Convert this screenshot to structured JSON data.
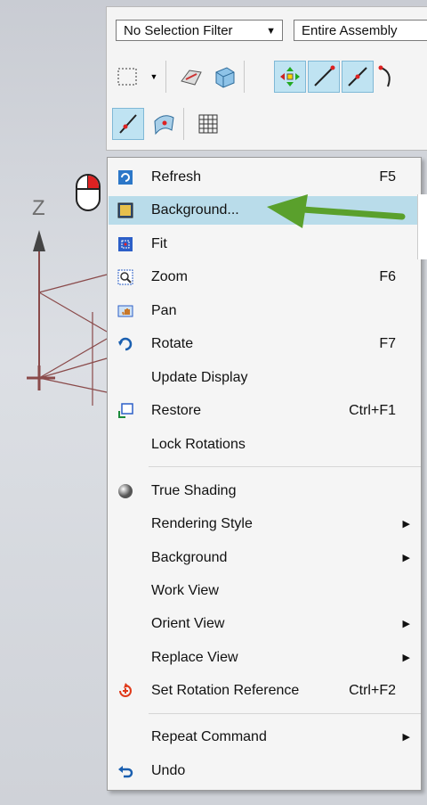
{
  "toolbar": {
    "selection_filter": "No Selection Filter",
    "scope": "Entire Assembly"
  },
  "axis": {
    "label": "Z"
  },
  "menu": {
    "items": [
      {
        "label": "Refresh",
        "shortcut": "F5"
      },
      {
        "label": "Background...",
        "shortcut": ""
      },
      {
        "label": "Fit",
        "shortcut": ""
      },
      {
        "label": "Zoom",
        "shortcut": "F6"
      },
      {
        "label": "Pan",
        "shortcut": ""
      },
      {
        "label": "Rotate",
        "shortcut": "F7"
      },
      {
        "label": "Update Display",
        "shortcut": ""
      },
      {
        "label": "Restore",
        "shortcut": "Ctrl+F1"
      },
      {
        "label": "Lock Rotations",
        "shortcut": ""
      },
      {
        "label": "True Shading",
        "shortcut": ""
      },
      {
        "label": "Rendering Style",
        "shortcut": ""
      },
      {
        "label": "Background",
        "shortcut": ""
      },
      {
        "label": "Work View",
        "shortcut": ""
      },
      {
        "label": "Orient View",
        "shortcut": ""
      },
      {
        "label": "Replace View",
        "shortcut": ""
      },
      {
        "label": "Set Rotation Reference",
        "shortcut": "Ctrl+F2"
      },
      {
        "label": "Repeat Command",
        "shortcut": ""
      },
      {
        "label": "Undo",
        "shortcut": ""
      }
    ]
  },
  "colors": {
    "highlight": "#b9dcea",
    "arrow": "#5aa02c",
    "axis": "#8a3a3a"
  }
}
